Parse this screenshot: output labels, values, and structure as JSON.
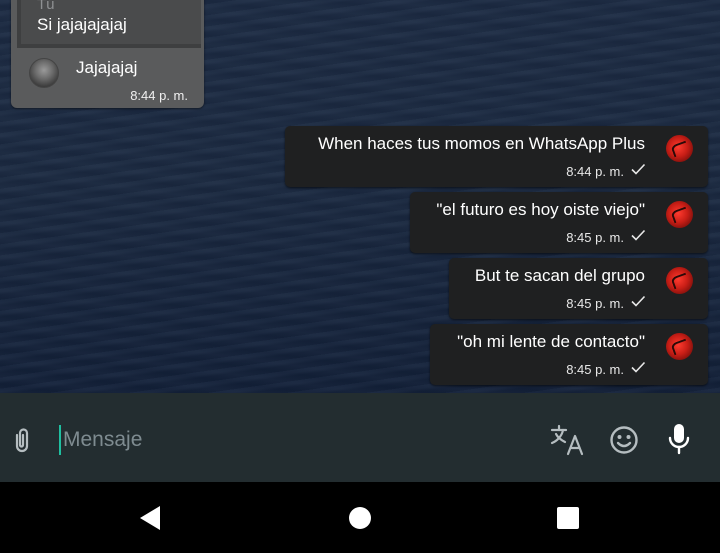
{
  "incoming_message": {
    "quoted_author": "Tú",
    "quoted_text": "Si jajajajajaj",
    "text": "Jajajajaj",
    "time": "8:44 p. m."
  },
  "outgoing_messages": [
    {
      "text": "When haces tus momos en WhatsApp Plus",
      "time": "8:44 p. m.",
      "status": "sent"
    },
    {
      "text": "\"el futuro es hoy oiste viejo\"",
      "time": "8:45 p. m.",
      "status": "sent"
    },
    {
      "text": "But te sacan del grupo",
      "time": "8:45 p. m.",
      "status": "sent"
    },
    {
      "text": "\"oh mi lente de contacto\"",
      "time": "8:45 p. m.",
      "status": "sent"
    }
  ],
  "composer": {
    "placeholder": "Mensaje",
    "icons": [
      "paperclip-icon",
      "translate-icon",
      "emoji-icon",
      "microphone-icon"
    ]
  },
  "navigation": {
    "buttons": [
      "back",
      "home",
      "recents"
    ]
  },
  "colors": {
    "accent": "#1fbfa0",
    "bubble_out": "#1f2021",
    "bubble_in": "#5a5b5c",
    "input_bar": "#232d30"
  }
}
